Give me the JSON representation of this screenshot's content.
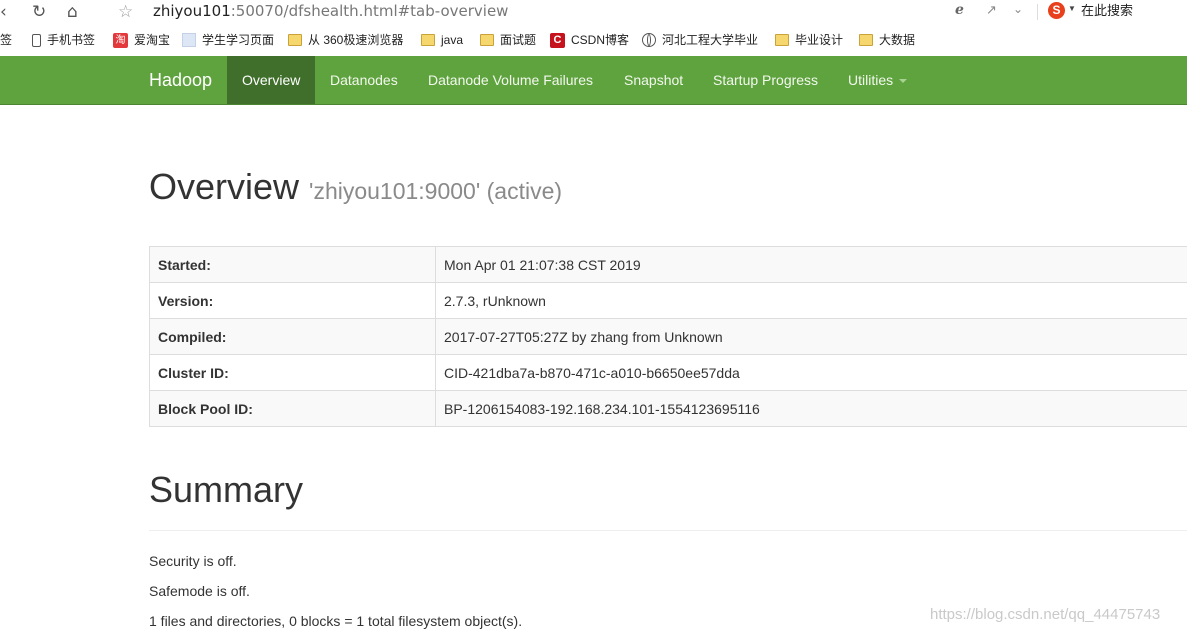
{
  "browser": {
    "address_host": "zhiyou101",
    "address_rest": ":50070/dfshealth.html#tab-overview",
    "search_engine_letter": "S",
    "search_label": "在此搜索"
  },
  "bookmarks": {
    "cut_label": "签",
    "items": [
      {
        "label": "手机书签",
        "icon": "phone-icon"
      },
      {
        "label": "爱淘宝",
        "icon": "taobao-icon",
        "glyph": "淘"
      },
      {
        "label": "学生学习页面",
        "icon": "page-icon"
      },
      {
        "label": "从 360极速浏览器",
        "icon": "folder-icon"
      },
      {
        "label": "java",
        "icon": "folder-icon"
      },
      {
        "label": "面试题",
        "icon": "folder-icon"
      },
      {
        "label": "CSDN博客",
        "icon": "csdn-icon",
        "glyph": "C"
      },
      {
        "label": "河北工程大学毕业",
        "icon": "globe-icon"
      },
      {
        "label": "毕业设计",
        "icon": "folder-icon"
      },
      {
        "label": "大数据",
        "icon": "folder-icon"
      }
    ]
  },
  "navbar": {
    "brand": "Hadoop",
    "items": [
      "Overview",
      "Datanodes",
      "Datanode Volume Failures",
      "Snapshot",
      "Startup Progress",
      "Utilities"
    ],
    "active": "Overview",
    "color": "#5fa33e"
  },
  "overview": {
    "title": "Overview",
    "subtitle": "'zhiyou101:9000' (active)",
    "rows": [
      {
        "key": "Started:",
        "value": "Mon Apr 01 21:07:38 CST 2019"
      },
      {
        "key": "Version:",
        "value": "2.7.3, rUnknown"
      },
      {
        "key": "Compiled:",
        "value": "2017-07-27T05:27Z by zhang from Unknown"
      },
      {
        "key": "Cluster ID:",
        "value": "CID-421dba7a-b870-471c-a010-b6650ee57dda"
      },
      {
        "key": "Block Pool ID:",
        "value": "BP-1206154083-192.168.234.101-1554123695116"
      }
    ]
  },
  "summary": {
    "title": "Summary",
    "lines": [
      "Security is off.",
      "Safemode is off.",
      "1 files and directories, 0 blocks = 1 total filesystem object(s)."
    ]
  },
  "watermark": "https://blog.csdn.net/qq_44475743"
}
